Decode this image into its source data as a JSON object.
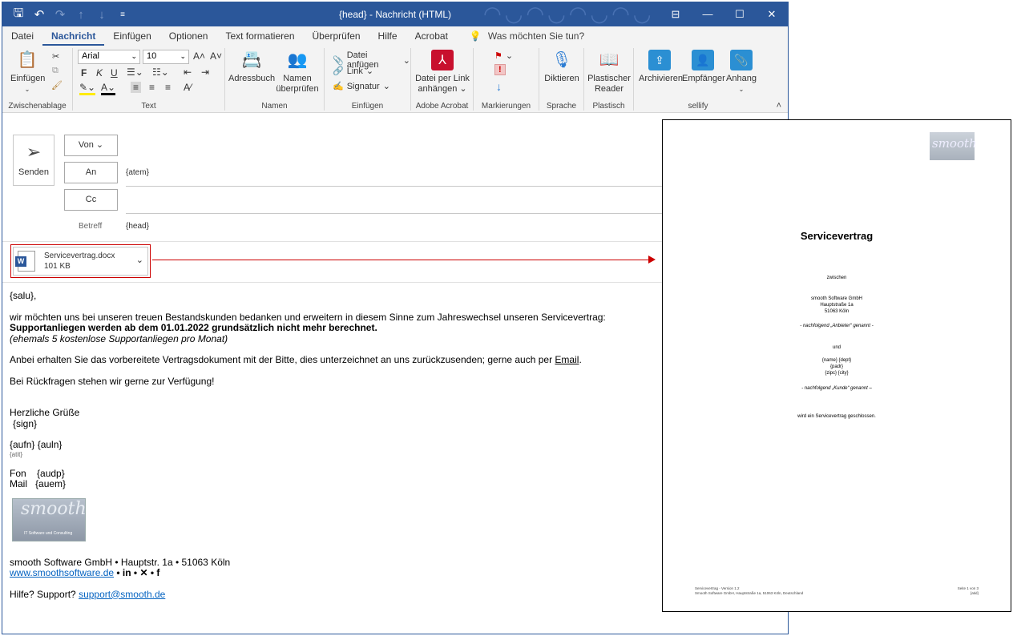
{
  "title": {
    "text": "{head}  -  Nachricht (HTML)"
  },
  "tabs": [
    "Datei",
    "Nachricht",
    "Einfügen",
    "Optionen",
    "Text formatieren",
    "Überprüfen",
    "Hilfe",
    "Acrobat"
  ],
  "tellme": "Was möchten Sie tun?",
  "ribbon": {
    "clipboard": {
      "label": "Zwischenablage",
      "paste": "Einfügen"
    },
    "text": {
      "label": "Text",
      "font": "Arial",
      "size": "10"
    },
    "names": {
      "label": "Namen",
      "addressbook": "Adressbuch",
      "check1": "Namen",
      "check2": "überprüfen"
    },
    "insert": {
      "label": "Einfügen",
      "file": "Datei anfügen",
      "link": "Link",
      "signature": "Signatur"
    },
    "acrobat": {
      "label": "Adobe Acrobat",
      "line1": "Datei per Link",
      "line2": "anhängen"
    },
    "markings": {
      "label": "Markierungen"
    },
    "speech": {
      "label": "Sprache",
      "dictate": "Diktieren"
    },
    "immersive": {
      "label": "Plastisch",
      "line1": "Plastischer",
      "line2": "Reader"
    },
    "sellify": {
      "label": "sellify",
      "archive": "Archivieren",
      "recipients": "Empfänger",
      "attachment": "Anhang"
    }
  },
  "compose": {
    "send": "Senden",
    "from": "Von",
    "to": "An",
    "to_value": "{atem}",
    "cc": "Cc",
    "subject_label": "Betreff",
    "subject_value": "{head}"
  },
  "attachment": {
    "name": "Servicevertrag.docx",
    "size": "101 KB"
  },
  "body": {
    "greeting": "{salu},",
    "p1": "wir möchten uns bei unseren treuen Bestandskunden bedanken und erweitern in diesem Sinne zum Jahreswechsel unseren Servicevertrag:",
    "p1_bold": "Supportanliegen werden ab dem 01.01.2022 grundsätzlich nicht mehr berechnet.",
    "p1_italic": "(ehemals 5 kostenlose Supportanliegen pro Monat)",
    "p2": "Anbei erhalten Sie das vorbereitete Vertragsdokument mit der Bitte, dies unterzeichnet an uns zurückzusenden; gerne auch per",
    "p2_link": "Email",
    "p3": "Bei Rückfragen stehen wir gerne zur Verfügung!",
    "closing": "Herzliche Grüße",
    "sign": "{sign}",
    "name": "{aufn} {auln}",
    "atit": "{atit}",
    "fon_label": "Fon",
    "fon": "{audp}",
    "mail_label": "Mail",
    "mail": "{auem}",
    "logo": "smooth",
    "logo_sub": "IT Software und Consulting",
    "company": "smooth Software GmbH • Hauptstr. 1a • 51063 Köln",
    "website": "www.smoothsoftware.de",
    "socials": " • in • ✕ • f",
    "help": "Hilfe? Support?",
    "support": "support@smooth.de"
  },
  "doc": {
    "logo": "smooth",
    "title": "Servicevertrag",
    "between": "zwischen",
    "c1": "smooth Software GmbH",
    "c2": "Hauptstraße 1a",
    "c3": "51063 Köln",
    "prov": "- nachfolgend „Anbieter“ genannt -",
    "and": "und",
    "k1": "{name} {dept}",
    "k2": "{padr}",
    "k3": "{zipc} {city}",
    "cust": "- nachfolgend „Kunde“ genannt –",
    "closed": "wird ein Servicevertrag geschlossen.",
    "foot1": "Servicevertrag - Version 1.2",
    "foot2": "Smooth Software GmbH, Hauptstraße 1a, 51063 Köln, Deutschland",
    "page": "Seite 1 von 3",
    "pagecode": "{atid}"
  },
  "colors": {
    "accent": "#2b579a",
    "arrow": "#cc0000",
    "link": "#0563c1"
  }
}
